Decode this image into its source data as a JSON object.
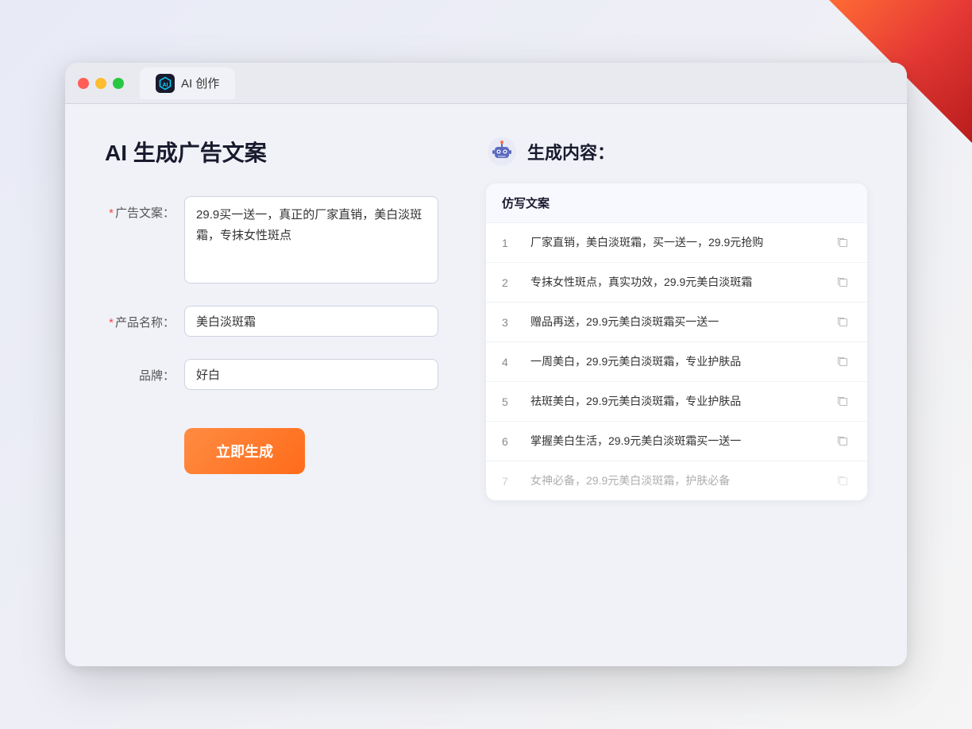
{
  "background": {
    "color": "#e8eaf6"
  },
  "browser": {
    "tab_title": "AI 创作",
    "tab_icon_text": "AI"
  },
  "left_panel": {
    "page_title": "AI 生成广告文案",
    "form": {
      "ad_copy_label": "广告文案：",
      "ad_copy_required": true,
      "ad_copy_value": "29.9买一送一，真正的厂家直销，美白淡斑霜，专抹女性斑点",
      "product_label": "产品名称：",
      "product_required": true,
      "product_value": "美白淡斑霜",
      "brand_label": "品牌：",
      "brand_required": false,
      "brand_value": "好白"
    },
    "generate_button": "立即生成"
  },
  "right_panel": {
    "title": "生成内容：",
    "table_header": "仿写文案",
    "results": [
      {
        "id": 1,
        "text": "厂家直销，美白淡斑霜，买一送一，29.9元抢购",
        "dimmed": false
      },
      {
        "id": 2,
        "text": "专抹女性斑点，真实功效，29.9元美白淡斑霜",
        "dimmed": false
      },
      {
        "id": 3,
        "text": "赠品再送，29.9元美白淡斑霜买一送一",
        "dimmed": false
      },
      {
        "id": 4,
        "text": "一周美白，29.9元美白淡斑霜，专业护肤品",
        "dimmed": false
      },
      {
        "id": 5,
        "text": "祛斑美白，29.9元美白淡斑霜，专业护肤品",
        "dimmed": false
      },
      {
        "id": 6,
        "text": "掌握美白生活，29.9元美白淡斑霜买一送一",
        "dimmed": false
      },
      {
        "id": 7,
        "text": "女神必备，29.9元美白淡斑霜，护肤必备",
        "dimmed": true
      }
    ]
  }
}
